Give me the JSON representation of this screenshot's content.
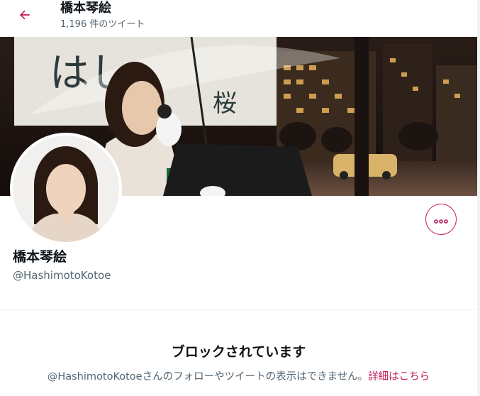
{
  "header": {
    "back_icon": "arrow-left-icon",
    "title": "橋本琴絵",
    "tweet_count": "1,196 件のツイート"
  },
  "profile": {
    "name": "橋本琴絵",
    "handle": "@HashimotoKotoe",
    "more_icon": "ellipsis-icon"
  },
  "blocked": {
    "title": "ブロックされています",
    "message": "@HashimotoKotoeさんのフォローやツイートの表示はできません。",
    "link": "詳細はこちら"
  },
  "colors": {
    "accent": "#c2185b",
    "secondary_text": "#536471",
    "primary_text": "#0f1419",
    "divider": "#eff3f4"
  }
}
